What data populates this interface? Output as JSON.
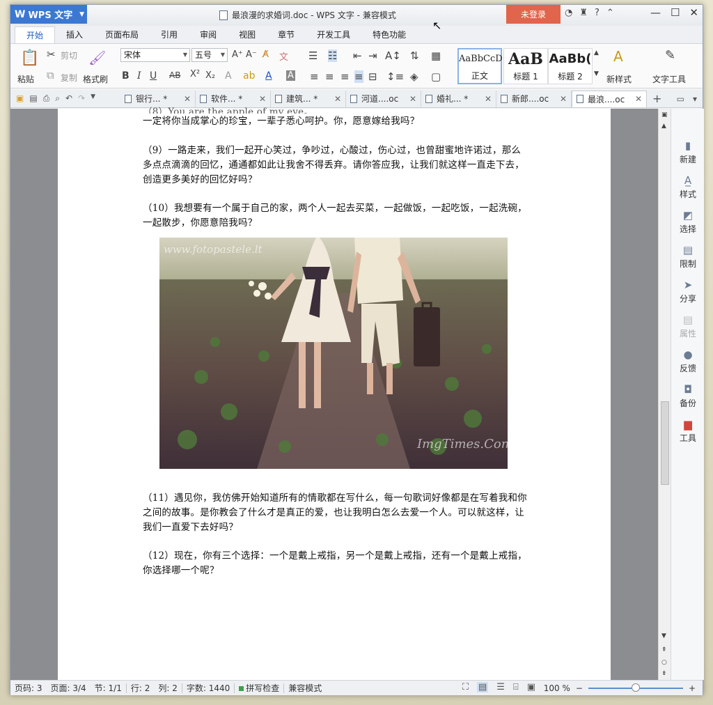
{
  "app": {
    "name": "WPS 文字",
    "window_title": "最浪漫的求婚词.doc - WPS 文字 - 兼容模式",
    "login_label": "未登录"
  },
  "menu_tabs": [
    "开始",
    "插入",
    "页面布局",
    "引用",
    "审阅",
    "视图",
    "章节",
    "开发工具",
    "特色功能"
  ],
  "ribbon": {
    "paste": "粘贴",
    "cut": "剪切",
    "copy": "复制",
    "format_painter": "格式刷",
    "font_name": "宋体",
    "font_size": "五号",
    "styles": [
      {
        "sample": "AaBbCcD",
        "name": "正文"
      },
      {
        "sample": "AaB",
        "name": "标题 1"
      },
      {
        "sample": "AaBb(",
        "name": "标题 2"
      }
    ],
    "new_style": "新样式",
    "text_tools": "文字工具"
  },
  "doc_tabs": [
    {
      "label": "银行... *"
    },
    {
      "label": "软件... *"
    },
    {
      "label": "建筑... *"
    },
    {
      "label": "河道....oc"
    },
    {
      "label": "婚礼... *"
    },
    {
      "label": "新郎....oc"
    },
    {
      "label": "最浪....oc"
    }
  ],
  "document": {
    "paragraphs": [
      "一定将你当成掌心的珍宝，一辈子悉心呵护。你，愿意嫁给我吗？",
      "（9）一路走来，我们一起开心笑过，争吵过，心酸过，伤心过，也曾甜蜜地许诺过，那么多点点滴滴的回忆，通通都如此让我舍不得丢弃。请你答应我，让我们就这样一直走下去，创造更多美好的回忆好吗？",
      "（10）我想要有一个属于自己的家，两个人一起去买菜，一起做饭，一起吃饭，一起洗碗，一起散步，你愿意陪我吗？",
      "（11）遇见你，我仿佛开始知道所有的情歌都在写什么，每一句歌词好像都是在写着我和你之间的故事。是你教会了什么才是真正的爱，也让我明白怎么去爱一个人。可以就这样，让我们一直爱下去好吗？",
      "（12）现在，你有三个选择：一个是戴上戒指，另一个是戴上戒指，还有一个是戴上戒指，你选择哪一个呢？"
    ],
    "photo_watermark_top": "www.fotopastele.lt",
    "photo_watermark_bottom": "ImgTimes.Com"
  },
  "side_panel": [
    "新建",
    "样式",
    "选择",
    "限制",
    "分享",
    "属性",
    "反馈",
    "备份",
    "工具"
  ],
  "status": {
    "page_num": "页码: 3",
    "pages": "页面: 3/4",
    "section": "节: 1/1",
    "row": "行: 2",
    "col": "列: 2",
    "word_count": "字数: 1440",
    "spellcheck": "拼写检查",
    "compat": "兼容模式",
    "zoom": "100 %"
  },
  "colors": {
    "accent": "#3b78d1",
    "login": "#e0654c"
  }
}
